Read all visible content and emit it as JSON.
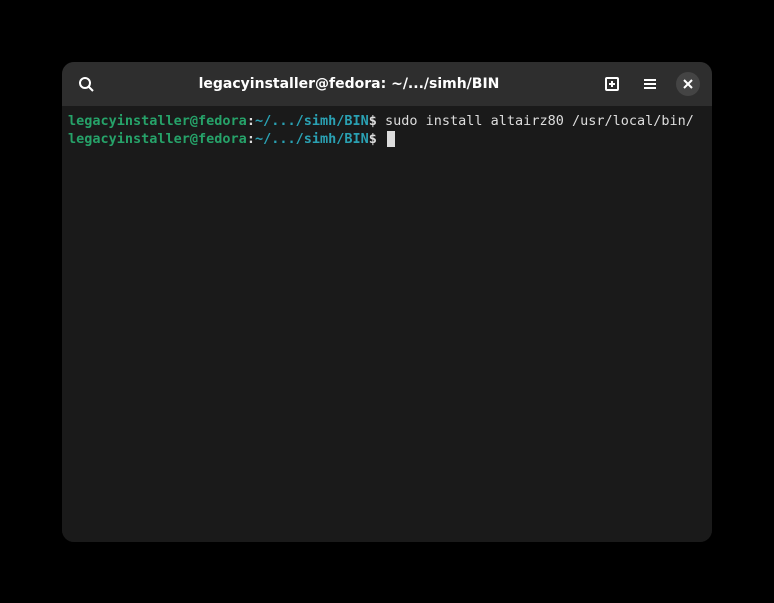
{
  "titlebar": {
    "title": "legacyinstaller@fedora: ~/.../simh/BIN"
  },
  "lines": [
    {
      "user_host": "legacyinstaller@fedora",
      "colon": ":",
      "path": "~/.../simh/BIN",
      "dollar": "$ ",
      "command": "sudo install altairz80 /usr/local/bin/"
    },
    {
      "user_host": "legacyinstaller@fedora",
      "colon": ":",
      "path": "~/.../simh/BIN",
      "dollar": "$ ",
      "command": ""
    }
  ]
}
